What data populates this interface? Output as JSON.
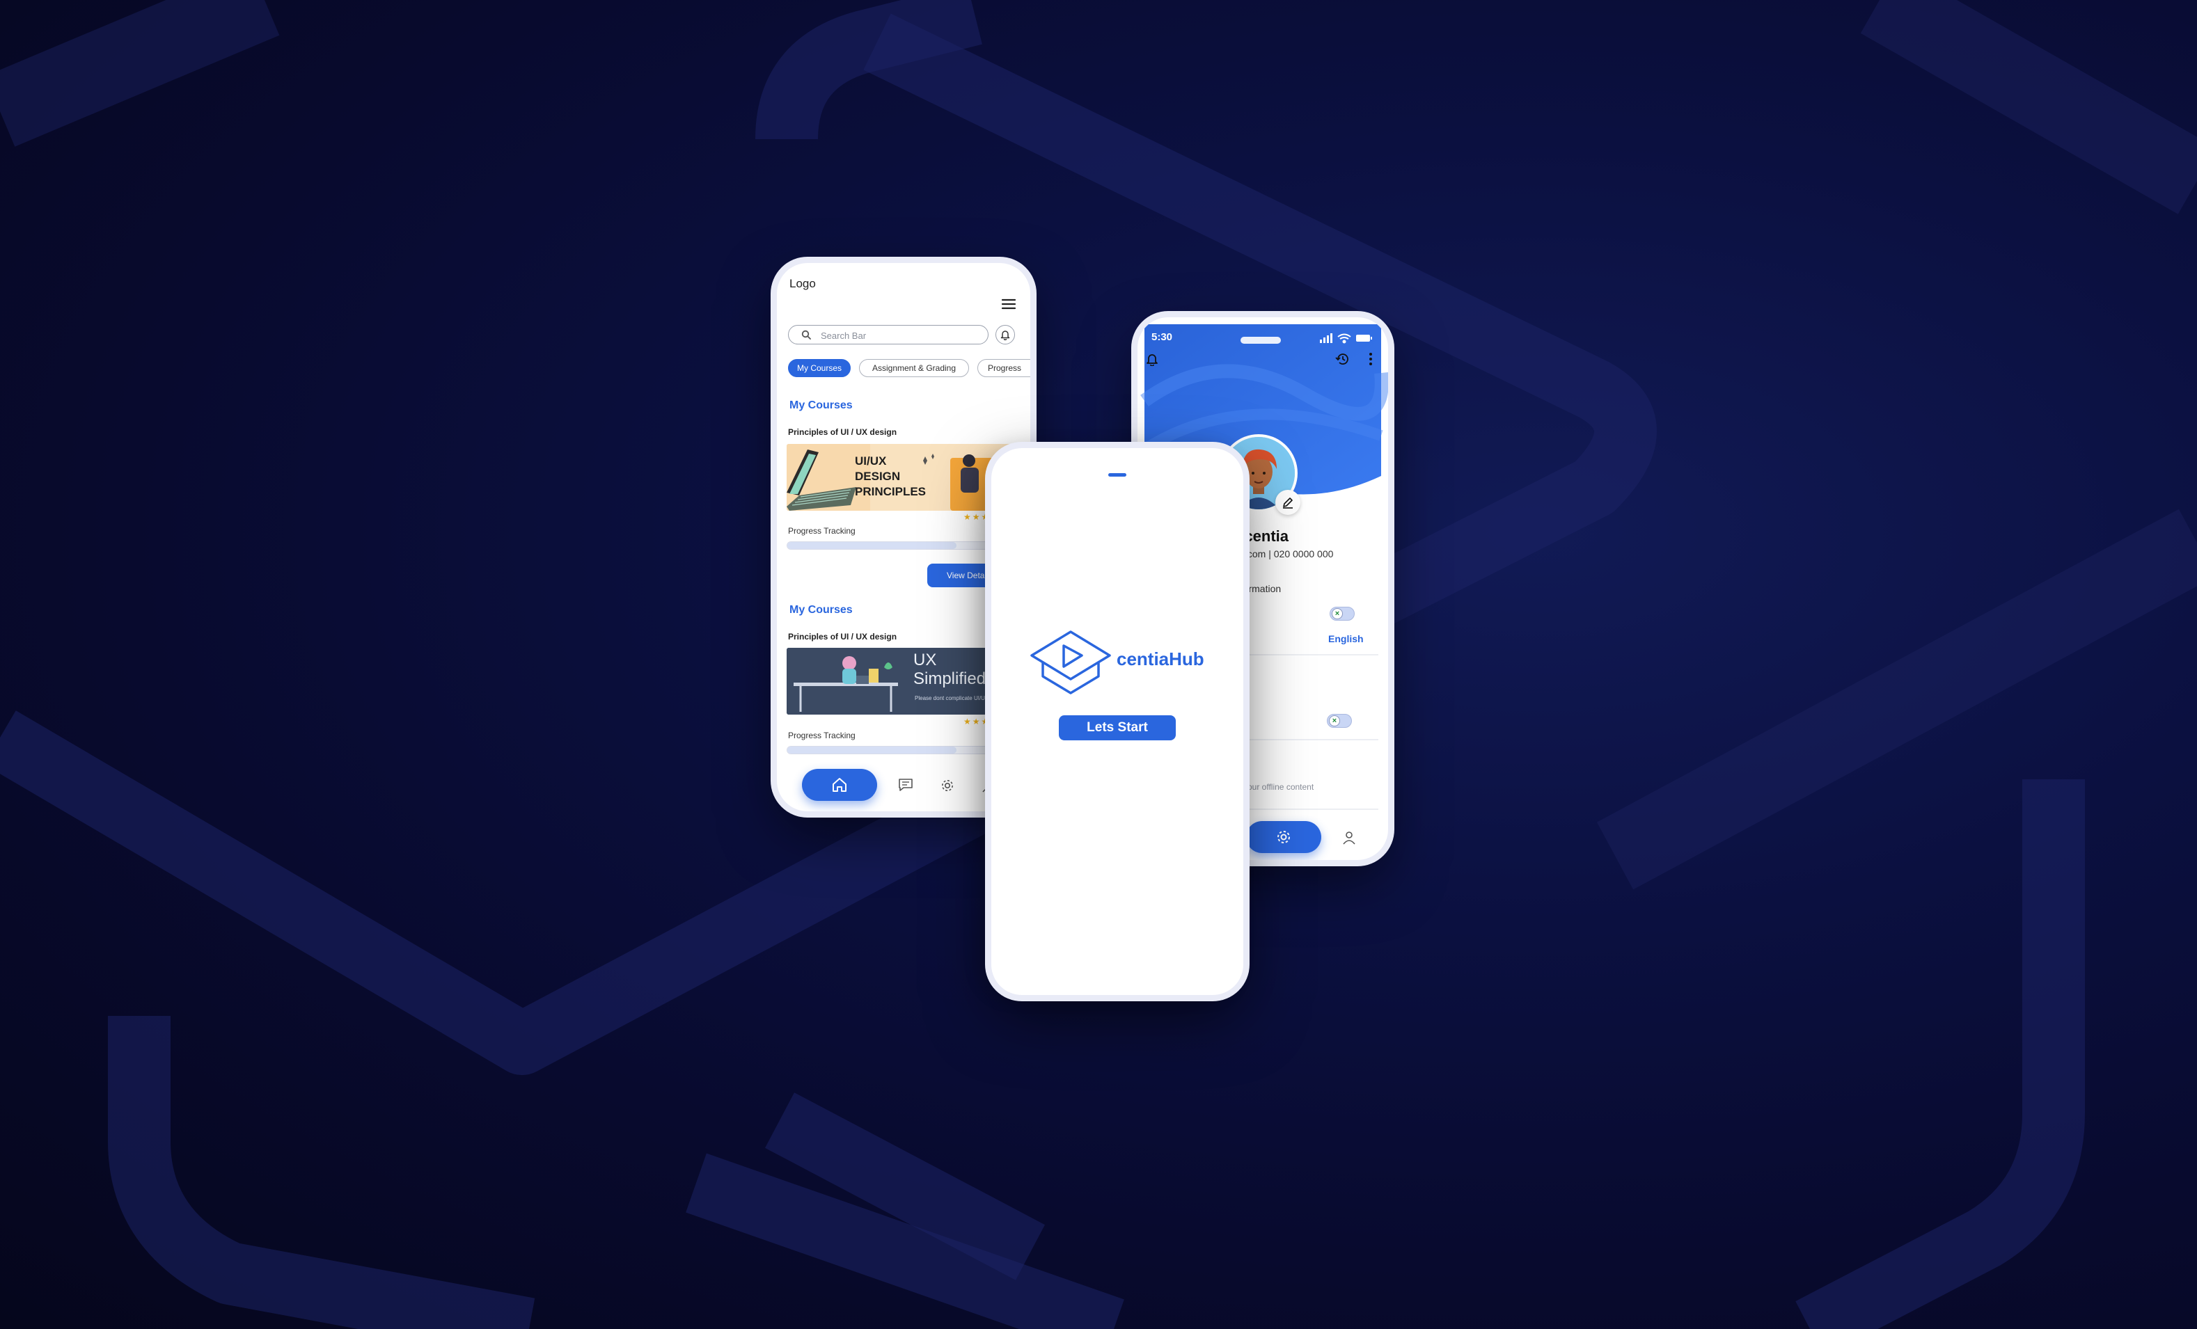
{
  "theme": {
    "accent": "#2a66de",
    "background": "#0b1040",
    "header_blue": "#2f6fe6"
  },
  "left_phone": {
    "logo": "Logo",
    "menu_icon": "hamburger-menu-icon",
    "search": {
      "placeholder": "Search Bar",
      "icon": "search-icon"
    },
    "notification_icon": "bell-icon",
    "tabs": [
      {
        "label": "My Courses",
        "active": true
      },
      {
        "label": "Assignment & Grading",
        "active": false
      },
      {
        "label": "Progress",
        "active": false
      }
    ],
    "courses": [
      {
        "section_title": "My Courses",
        "course_name": "Principles of UI / UX design",
        "banner_lines": [
          "UI/UX",
          "DESIGN",
          "PRINCIPLES"
        ],
        "stars": "★★★",
        "progress_label": "Progress Tracking",
        "progress": 0.72,
        "button_label": "View Details"
      },
      {
        "section_title": "My Courses",
        "course_name": "Principles of UI / UX design",
        "banner_title": "UX Simplified",
        "banner_subtitle": "Please dont complicate UI/UX",
        "stars": "★★★",
        "progress_label": "Progress Tracking",
        "progress": 0.72
      }
    ],
    "bottom_nav": [
      "home-icon",
      "chat-icon",
      "settings-icon",
      "user-icon"
    ]
  },
  "middle_phone": {
    "brand": "centiaHub",
    "logo_icon": "graduation-cap-play-icon",
    "start_button": "Lets Start"
  },
  "right_phone": {
    "time": "5:30",
    "status_icons": [
      "signal-icon",
      "wifi-icon",
      "battery-icon"
    ],
    "header_icons": [
      "bell-icon",
      "history-icon",
      "more-vertical-icon"
    ],
    "name": "ncentia",
    "contact": "ail.com | 020 0000 000",
    "section_label": "nformation",
    "language": "English",
    "offline_text": "your offline content",
    "toggles": [
      false,
      false
    ],
    "bottom_nav": [
      "settings-icon",
      "user-icon"
    ]
  }
}
